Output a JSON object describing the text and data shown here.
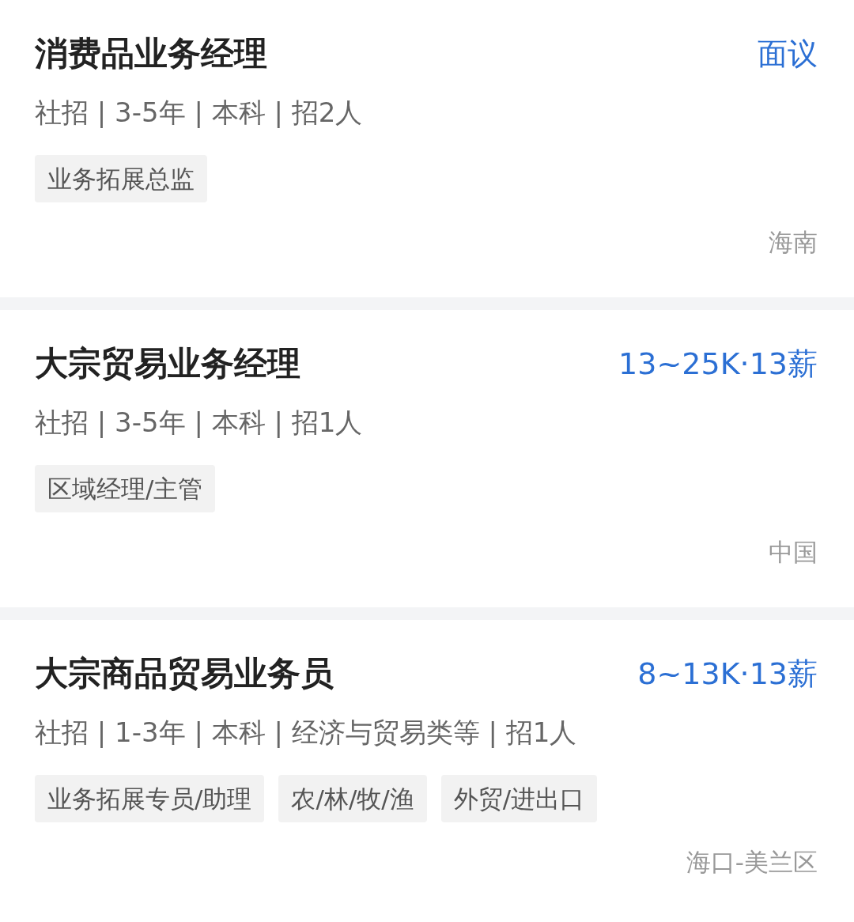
{
  "jobs": [
    {
      "title": "消费品业务经理",
      "salary": "面议",
      "meta": "社招 | 3-5年 | 本科 | 招2人",
      "tags": [
        "业务拓展总监"
      ],
      "location": "海南"
    },
    {
      "title": "大宗贸易业务经理",
      "salary": "13~25K·13薪",
      "meta": "社招 | 3-5年 | 本科 | 招1人",
      "tags": [
        "区域经理/主管"
      ],
      "location": "中国"
    },
    {
      "title": "大宗商品贸易业务员",
      "salary": "8~13K·13薪",
      "meta": "社招 | 1-3年 | 本科 | 经济与贸易类等 | 招1人",
      "tags": [
        "业务拓展专员/助理",
        "农/林/牧/渔",
        "外贸/进出口"
      ],
      "location": "海口-美兰区"
    }
  ]
}
